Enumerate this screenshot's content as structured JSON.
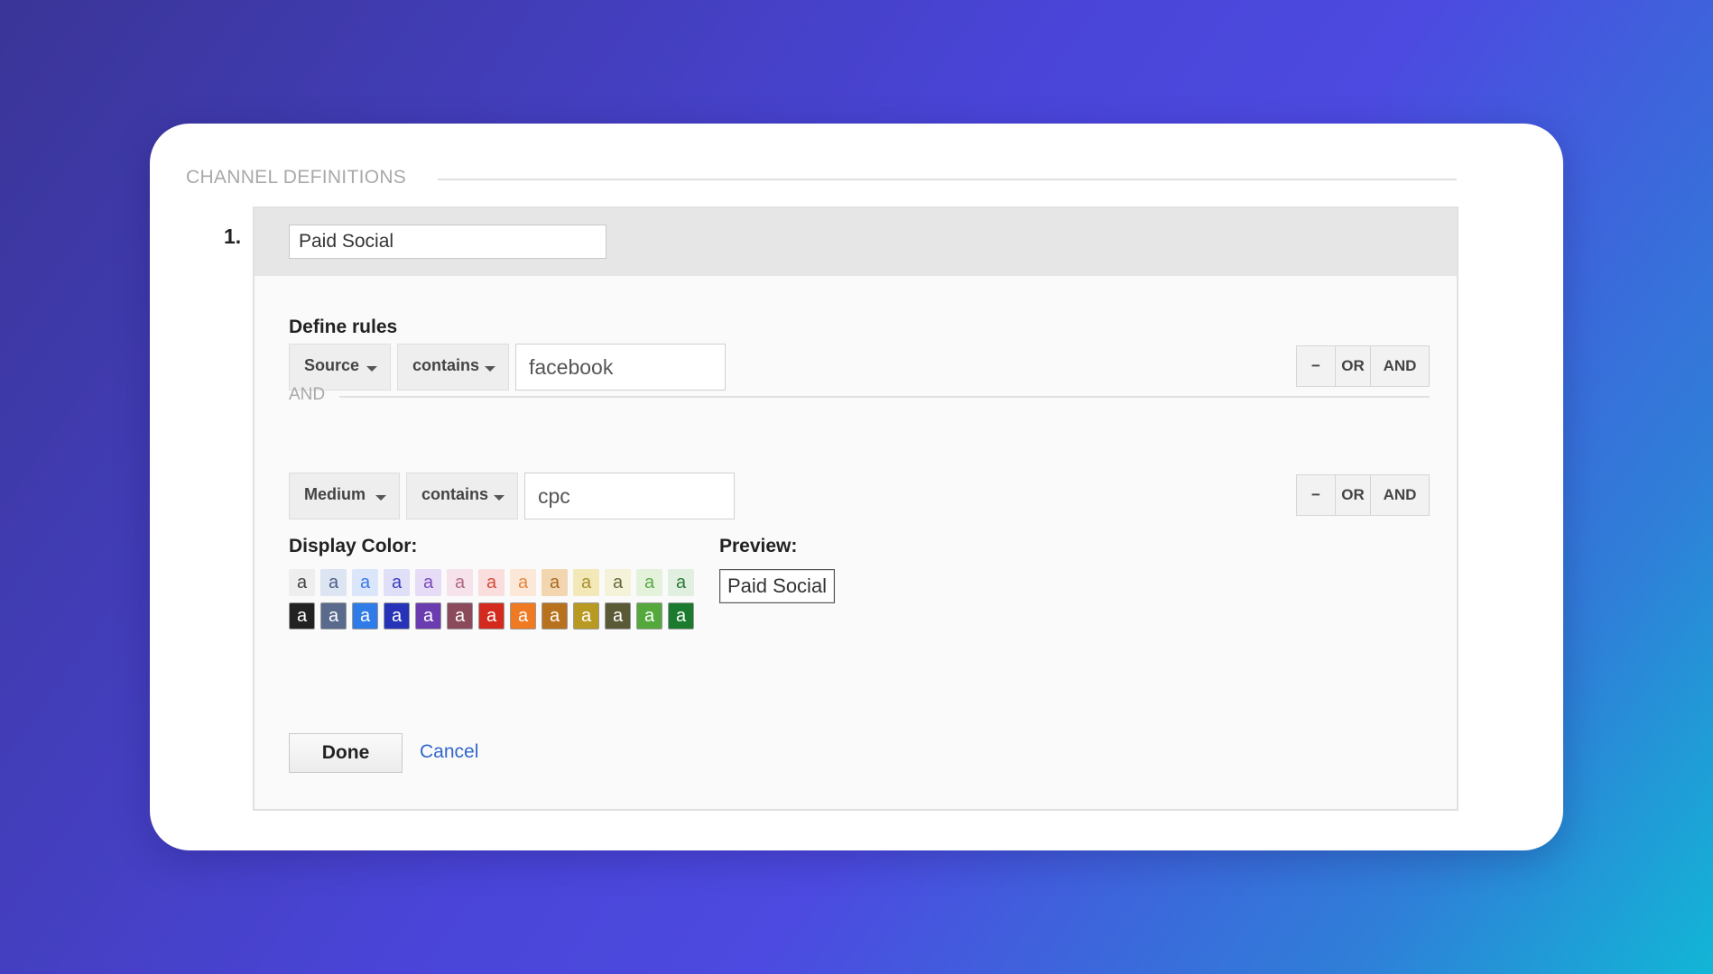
{
  "section": {
    "title": "CHANNEL DEFINITIONS"
  },
  "channel": {
    "number": "1.",
    "name": "Paid Social"
  },
  "rules": {
    "heading": "Define rules",
    "row1": {
      "dimension": "Source",
      "operator": "contains",
      "value": "facebook"
    },
    "separator": "AND",
    "row2": {
      "dimension": "Medium",
      "operator": "contains",
      "value": "cpc"
    },
    "buttons": {
      "remove": "−",
      "or": "OR",
      "and": "AND"
    }
  },
  "display_color": {
    "label": "Display Color:",
    "swatch_glyph": "a",
    "light_row": [
      {
        "bg": "#eeeeee",
        "fg": "#444444"
      },
      {
        "bg": "#dde4f2",
        "fg": "#4a5f8a"
      },
      {
        "bg": "#dbe6fb",
        "fg": "#3a78e8"
      },
      {
        "bg": "#dfdff8",
        "fg": "#3d3dc0"
      },
      {
        "bg": "#e6dcf6",
        "fg": "#7a4cc0"
      },
      {
        "bg": "#f6e2ea",
        "fg": "#b06a80"
      },
      {
        "bg": "#f9dedd",
        "fg": "#d84a3c"
      },
      {
        "bg": "#fbe8d8",
        "fg": "#e8843c"
      },
      {
        "bg": "#f2d6b0",
        "fg": "#a86a24"
      },
      {
        "bg": "#f2e8b8",
        "fg": "#a8902a"
      },
      {
        "bg": "#f4f2d8",
        "fg": "#6a6a40"
      },
      {
        "bg": "#e4f2dc",
        "fg": "#5aa84a"
      },
      {
        "bg": "#e0efe0",
        "fg": "#2a7a38"
      }
    ],
    "dark_row": [
      {
        "bg": "#222222",
        "fg": "#ffffff"
      },
      {
        "bg": "#5a6a8c",
        "fg": "#ffffff"
      },
      {
        "bg": "#2f7be8",
        "fg": "#ffffff"
      },
      {
        "bg": "#2633b8",
        "fg": "#ffffff"
      },
      {
        "bg": "#6a3cb0",
        "fg": "#ffffff"
      },
      {
        "bg": "#8a4a5c",
        "fg": "#ffffff"
      },
      {
        "bg": "#d42a1e",
        "fg": "#ffffff"
      },
      {
        "bg": "#ef7a22",
        "fg": "#ffffff"
      },
      {
        "bg": "#b8721e",
        "fg": "#ffffff"
      },
      {
        "bg": "#b89a22",
        "fg": "#ffffff"
      },
      {
        "bg": "#5a5a36",
        "fg": "#ffffff"
      },
      {
        "bg": "#54a83c",
        "fg": "#ffffff"
      },
      {
        "bg": "#1a7a2e",
        "fg": "#ffffff"
      }
    ]
  },
  "preview": {
    "label": "Preview:",
    "text": "Paid Social"
  },
  "actions": {
    "done": "Done",
    "cancel": "Cancel"
  }
}
